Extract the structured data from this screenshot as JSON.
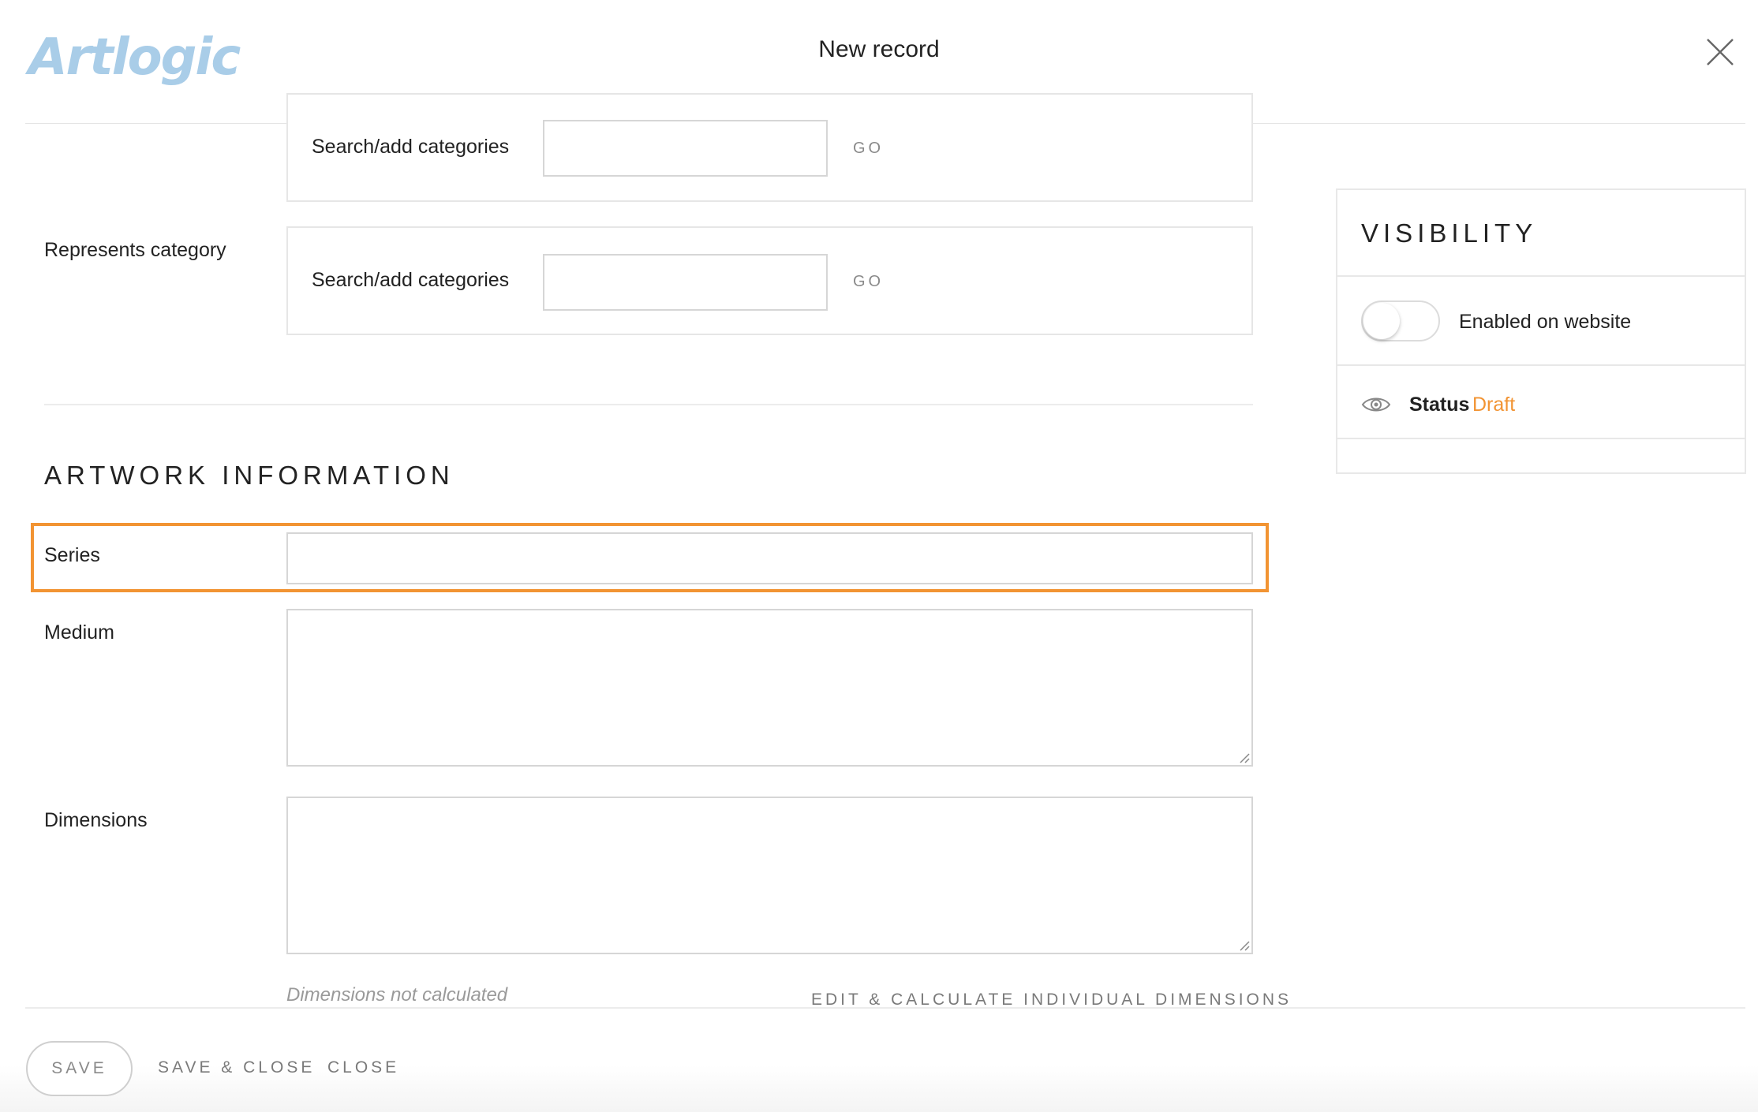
{
  "header": {
    "logo_text": "Artlogic",
    "title": "New record"
  },
  "categories": {
    "first_label": "Search/add categories",
    "first_go": "GO",
    "represents_label": "Represents category",
    "represents_search_label": "Search/add categories",
    "represents_go": "GO"
  },
  "artwork": {
    "section_title": "ARTWORK INFORMATION",
    "series_label": "Series",
    "series_value": "",
    "medium_label": "Medium",
    "medium_value": "",
    "dimensions_label": "Dimensions",
    "dimensions_value": "",
    "dimensions_note": "Dimensions not calculated",
    "calc_link": "EDIT & CALCULATE INDIVIDUAL DIMENSIONS"
  },
  "visibility": {
    "title": "VISIBILITY",
    "toggle_label": "Enabled on website",
    "toggle_on": false,
    "status_label": "Status",
    "status_value": "Draft",
    "status_color": "#f29433"
  },
  "footer": {
    "save": "SAVE",
    "save_close": "SAVE & CLOSE",
    "close": "CLOSE"
  },
  "colors": {
    "accent": "#f29433",
    "logo": "#a9cde8"
  }
}
